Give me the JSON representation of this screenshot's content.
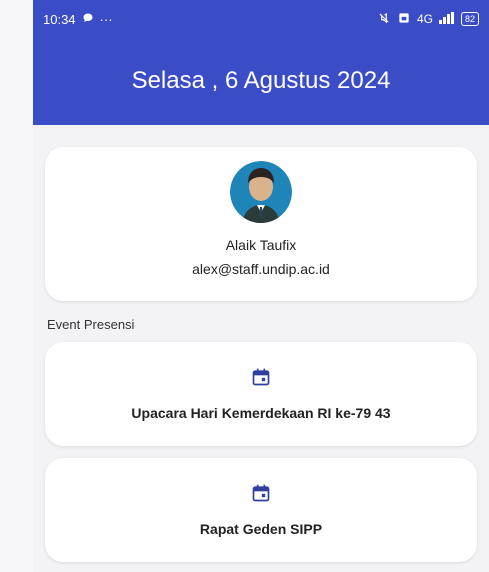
{
  "status_bar": {
    "time": "10:34",
    "more_dots": "···",
    "network": "4G",
    "battery": "82"
  },
  "header": {
    "title": "Selasa , 6 Agustus 2024",
    "color": "#3b4cc7"
  },
  "profile": {
    "name": "Alaik Taufix",
    "email": "alex@staff.undip.ac.id"
  },
  "section": {
    "title": "Event Presensi"
  },
  "events": [
    {
      "label": "Upacara Hari Kemerdekaan RI ke-79 43",
      "icon": "calendar-icon"
    },
    {
      "label": "Rapat Geden SIPP",
      "icon": "calendar-icon"
    }
  ]
}
